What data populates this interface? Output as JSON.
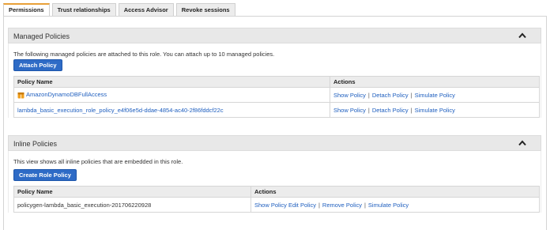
{
  "tabs": [
    {
      "label": "Permissions"
    },
    {
      "label": "Trust relationships"
    },
    {
      "label": "Access Advisor"
    },
    {
      "label": "Revoke sessions"
    }
  ],
  "managed": {
    "title": "Managed Policies",
    "description": "The following managed policies are attached to this role. You can attach up to 10 managed policies.",
    "attach_label": "Attach Policy",
    "col_name": "Policy Name",
    "col_actions": "Actions",
    "rows": [
      {
        "name": "AmazonDynamoDBFullAccess",
        "show": "Show Policy",
        "detach": "Detach Policy",
        "simulate": "Simulate Policy"
      },
      {
        "name": "lambda_basic_execution_role_policy_e4f06e5d-ddae-4854-ac40-2f86fddcf22c",
        "show": "Show Policy",
        "detach": "Detach Policy",
        "simulate": "Simulate Policy"
      }
    ]
  },
  "inline": {
    "title": "Inline Policies",
    "description": "This view shows all inline policies that are embedded in this role.",
    "create_label": "Create Role Policy",
    "col_name": "Policy Name",
    "col_actions": "Actions",
    "rows": [
      {
        "name": "policygen-lambda_basic_execution-201706220928",
        "show": "Show Policy",
        "edit": "Edit Policy",
        "remove": "Remove Policy",
        "simulate": "Simulate Policy"
      }
    ]
  },
  "separator": "|",
  "colors": {
    "tab_accent": "#e8a038",
    "button": "#2e6bc6",
    "link": "#1f5fbf",
    "aws_icon": "#f0a020"
  },
  "icons": {
    "collapse": "chevron-up-icon",
    "aws_managed": "aws-policy-cube-icon"
  }
}
